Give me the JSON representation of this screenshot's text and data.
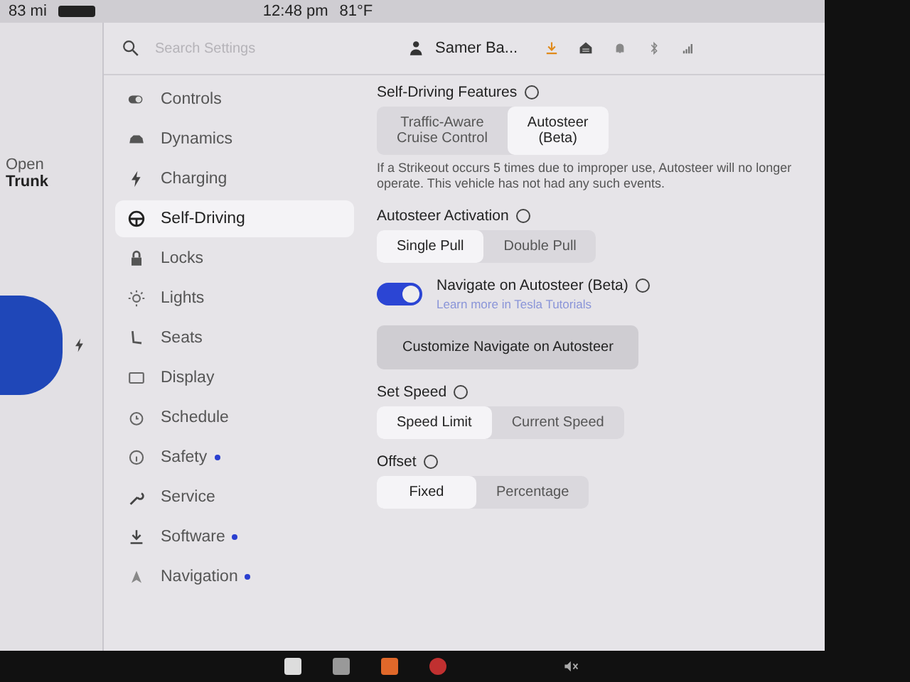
{
  "status_bar": {
    "range": "83 mi",
    "time": "12:48 pm",
    "temperature": "81°F"
  },
  "car_panel": {
    "trunk_label": "Open",
    "trunk_action": "Trunk"
  },
  "search": {
    "placeholder": "Search Settings"
  },
  "header": {
    "profile": "Samer Ba..."
  },
  "sidebar": {
    "items": [
      {
        "label": "Controls",
        "selected": false,
        "dot": false
      },
      {
        "label": "Dynamics",
        "selected": false,
        "dot": false
      },
      {
        "label": "Charging",
        "selected": false,
        "dot": false
      },
      {
        "label": "Self-Driving",
        "selected": true,
        "dot": false
      },
      {
        "label": "Locks",
        "selected": false,
        "dot": false
      },
      {
        "label": "Lights",
        "selected": false,
        "dot": false
      },
      {
        "label": "Seats",
        "selected": false,
        "dot": false
      },
      {
        "label": "Display",
        "selected": false,
        "dot": false
      },
      {
        "label": "Schedule",
        "selected": false,
        "dot": false
      },
      {
        "label": "Safety",
        "selected": false,
        "dot": true
      },
      {
        "label": "Service",
        "selected": false,
        "dot": false
      },
      {
        "label": "Software",
        "selected": false,
        "dot": true
      },
      {
        "label": "Navigation",
        "selected": false,
        "dot": true
      }
    ]
  },
  "sections": [
    {
      "kind": "segmented",
      "title": "Self-Driving Features",
      "options": [
        {
          "label": "Traffic-Aware\nCruise Control",
          "selected": false
        },
        {
          "label": "Autosteer\n(Beta)",
          "selected": true
        }
      ],
      "note": "If a Strikeout occurs 5 times due to improper use, Autosteer will no longer operate. This vehicle has not had any such events."
    },
    {
      "kind": "segmented",
      "title": "Autosteer Activation",
      "options": [
        {
          "label": "Single Pull",
          "selected": true
        },
        {
          "label": "Double Pull",
          "selected": false
        }
      ]
    },
    {
      "kind": "toggle",
      "title": "Navigate on Autosteer (Beta)",
      "on": true,
      "link": "Learn more in Tesla Tutorials"
    },
    {
      "kind": "button",
      "label": "Customize Navigate on Autosteer"
    },
    {
      "kind": "segmented",
      "title": "Set Speed",
      "options": [
        {
          "label": "Speed Limit",
          "selected": true
        },
        {
          "label": "Current Speed",
          "selected": false
        }
      ]
    },
    {
      "kind": "segmented",
      "title": "Offset",
      "options": [
        {
          "label": "Fixed",
          "selected": true
        },
        {
          "label": "Percentage",
          "selected": false
        }
      ]
    }
  ]
}
